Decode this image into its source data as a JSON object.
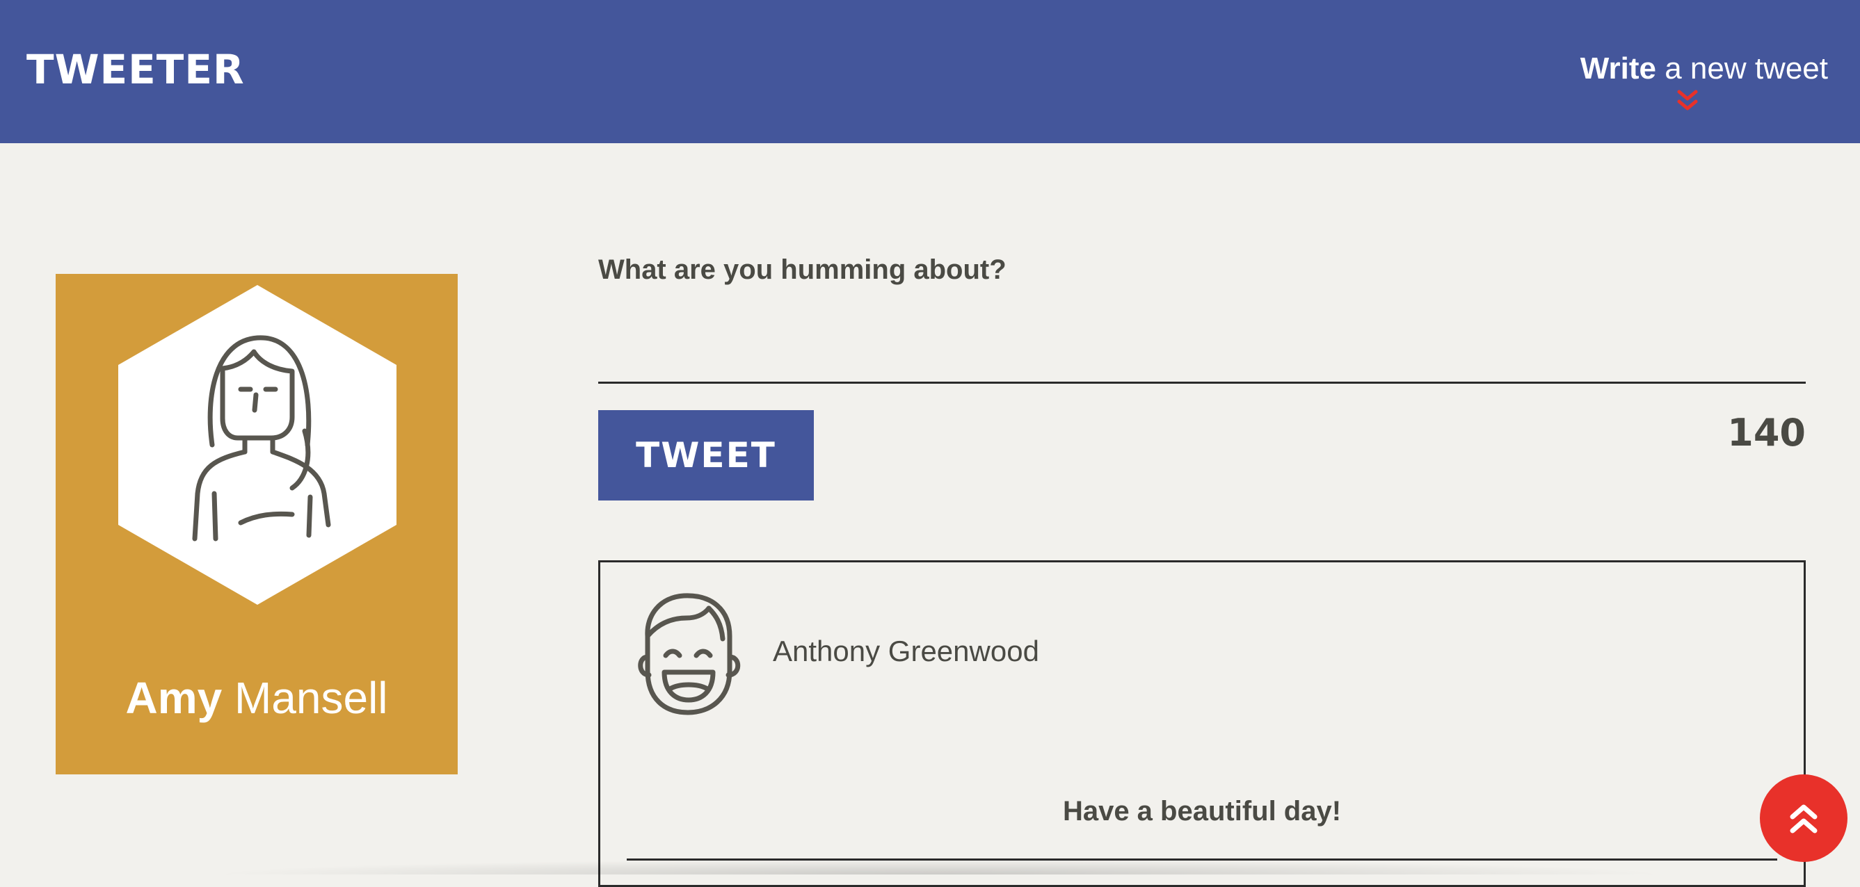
{
  "header": {
    "logo": "TWEETER",
    "compose_toggle": {
      "strong": "Write",
      "rest": " a new tweet",
      "icon": "chevron-double-down-icon",
      "icon_color": "#e8312a"
    },
    "background": "#44569b"
  },
  "profile": {
    "first_name": "Amy",
    "last_name": " Mansell",
    "avatar_icon": "woman-avatar-icon",
    "card_color": "#d39c3b"
  },
  "compose": {
    "label": "What are you humming about?",
    "input_value": "",
    "input_placeholder": "",
    "button_label": "TWEET",
    "char_count": "140"
  },
  "tweets": [
    {
      "author": "Anthony Greenwood",
      "avatar_icon": "smiling-man-avatar-icon",
      "content": "Have a beautiful day!"
    }
  ],
  "scroll_top": {
    "icon": "chevron-double-up-icon",
    "color": "#e8312a"
  }
}
